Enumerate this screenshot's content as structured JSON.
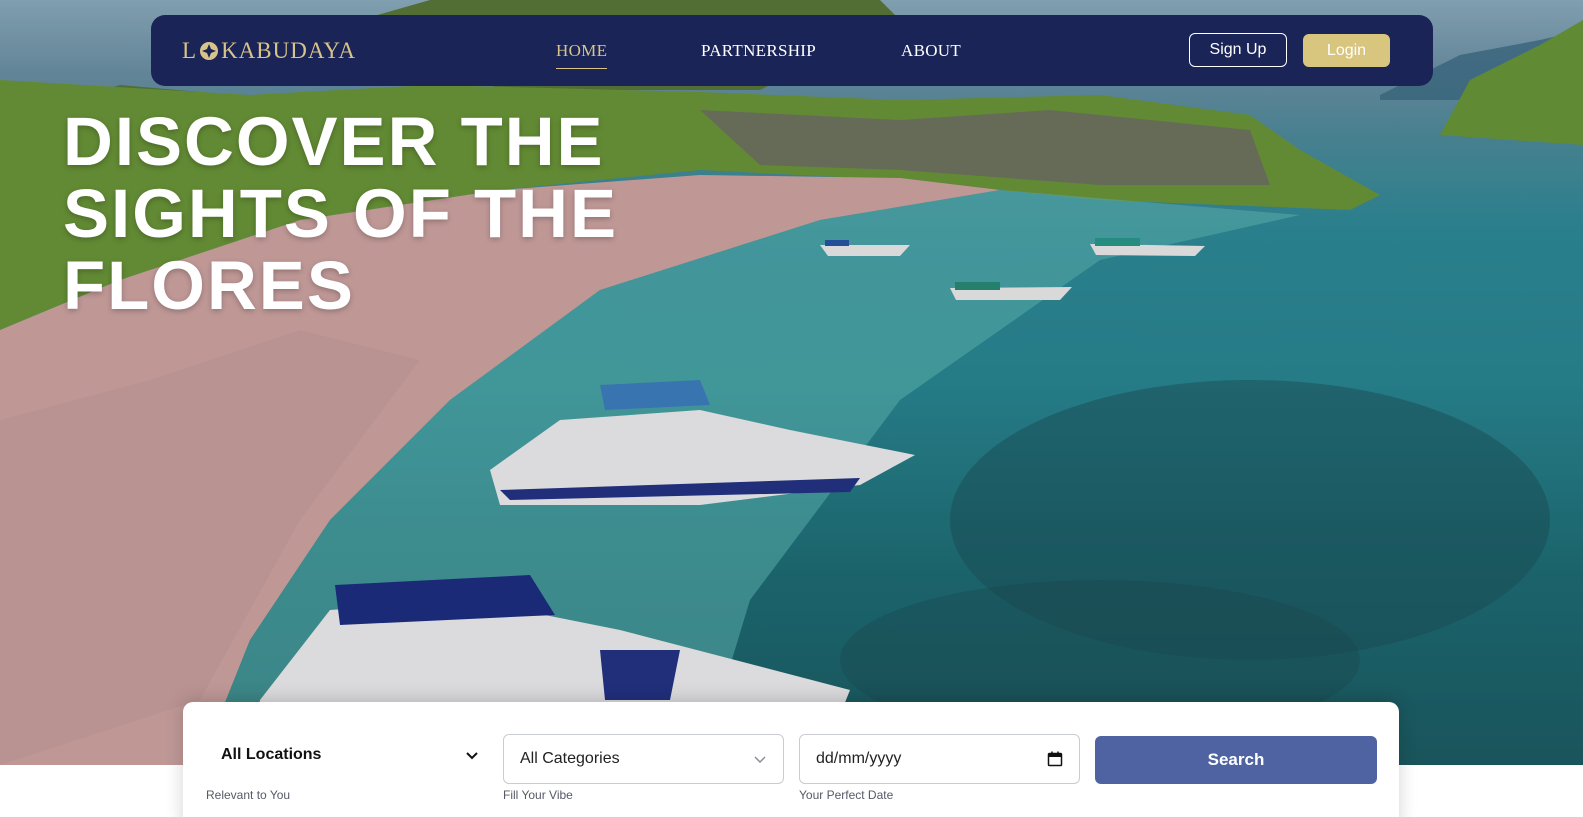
{
  "brand": {
    "logo_text_before": "L",
    "logo_text_after": "KABUDAYA",
    "color_primary": "#1a2456",
    "color_accent": "#d8c57e",
    "logo_icon": "compass-star-icon"
  },
  "nav": {
    "items": [
      {
        "label": "HOME",
        "active": true
      },
      {
        "label": "PARTNERSHIP",
        "active": false
      },
      {
        "label": "ABOUT",
        "active": false
      }
    ],
    "signup_label": "Sign Up",
    "login_label": "Login"
  },
  "hero": {
    "headline_lines": [
      "DISCOVER THE",
      "SIGHTS OF THE",
      "FLORES"
    ]
  },
  "search": {
    "location": {
      "value": "All Locations",
      "label": "Relevant to You",
      "icon": "chevron-down-icon"
    },
    "category": {
      "value": "All Categories",
      "label": "Fill Your Vibe",
      "icon": "chevron-down-icon"
    },
    "date": {
      "placeholder": "dd/mm/yyyy",
      "label": "Your Perfect Date",
      "icon": "calendar-icon"
    },
    "button_label": "Search",
    "button_color": "#4f62a2"
  }
}
